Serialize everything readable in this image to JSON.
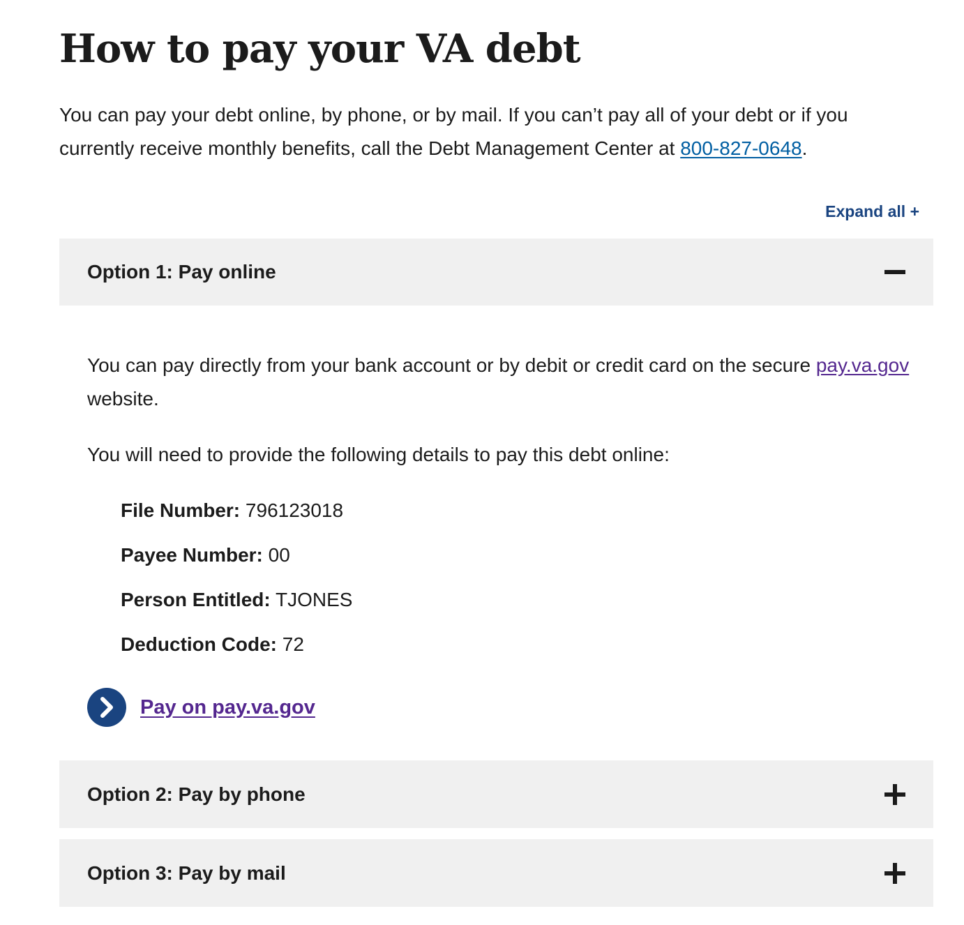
{
  "page": {
    "title": "How to pay your VA debt",
    "intro": {
      "text_before": "You can pay your debt online, by phone, or by mail. If you can’t pay all of your debt or if you currently receive monthly benefits, call the Debt Management Center at ",
      "phone_link": "800-827-0648",
      "text_after": "."
    },
    "expand_all_label": "Expand all +"
  },
  "accordion": [
    {
      "title": "Option 1: Pay online",
      "state": "expanded",
      "icon": "minus-icon",
      "content": {
        "para1_before": "You can pay directly from your bank account or by debit or credit card on the secure ",
        "para1_link": "pay.va.gov",
        "para1_after": " website.",
        "para2": "You will need to provide the following details to pay this debt online:",
        "details": [
          {
            "label": "File Number:",
            "value": "796123018"
          },
          {
            "label": "Payee Number:",
            "value": "00"
          },
          {
            "label": "Person Entitled:",
            "value": "TJONES"
          },
          {
            "label": "Deduction Code:",
            "value": "72"
          }
        ],
        "action_link": "Pay on pay.va.gov",
        "action_icon": "chevron-right-circle-icon"
      }
    },
    {
      "title": "Option 2: Pay by phone",
      "state": "collapsed",
      "icon": "plus-icon"
    },
    {
      "title": "Option 3: Pay by mail",
      "state": "collapsed",
      "icon": "plus-icon"
    }
  ],
  "colors": {
    "accordion_bg": "#f0f0f0",
    "link_blue": "#005ea2",
    "link_visited": "#54278f",
    "action_circle": "#1a4480",
    "text": "#1b1b1b"
  }
}
